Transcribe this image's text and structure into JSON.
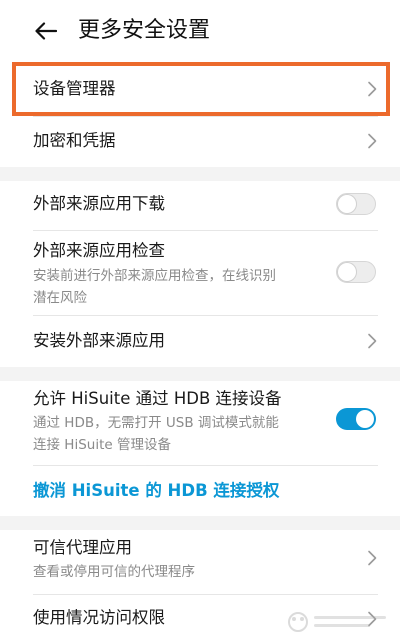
{
  "header": {
    "title": "更多安全设置",
    "back_icon": "arrow-left-icon"
  },
  "items": {
    "device_manager": "设备管理器",
    "encryption": "加密和凭据",
    "external_download": {
      "title": "外部来源应用下载",
      "enabled": false
    },
    "external_check": {
      "title": "外部来源应用检查",
      "desc_line1": "安装前进行外部来源应用检查，在线识别",
      "desc_line2": "潜在风险",
      "enabled": false
    },
    "install_external": "安装外部来源应用",
    "hisuite": {
      "title": "允许 HiSuite 通过 HDB 连接设备",
      "desc_line1": "通过 HDB，无需打开 USB 调试模式就能",
      "desc_line2": "连接 HiSuite 管理设备",
      "enabled": true
    },
    "revoke_link": "撤消 HiSuite 的 HDB 连接授权",
    "trusted_agents": {
      "title": "可信代理应用",
      "desc": "查看或停用可信的代理程序"
    },
    "usage_access": "使用情况访问权限"
  },
  "colors": {
    "accent": "#0b97d5",
    "highlight": "#ec6a2c",
    "section_gap": "#f3f3f3"
  }
}
